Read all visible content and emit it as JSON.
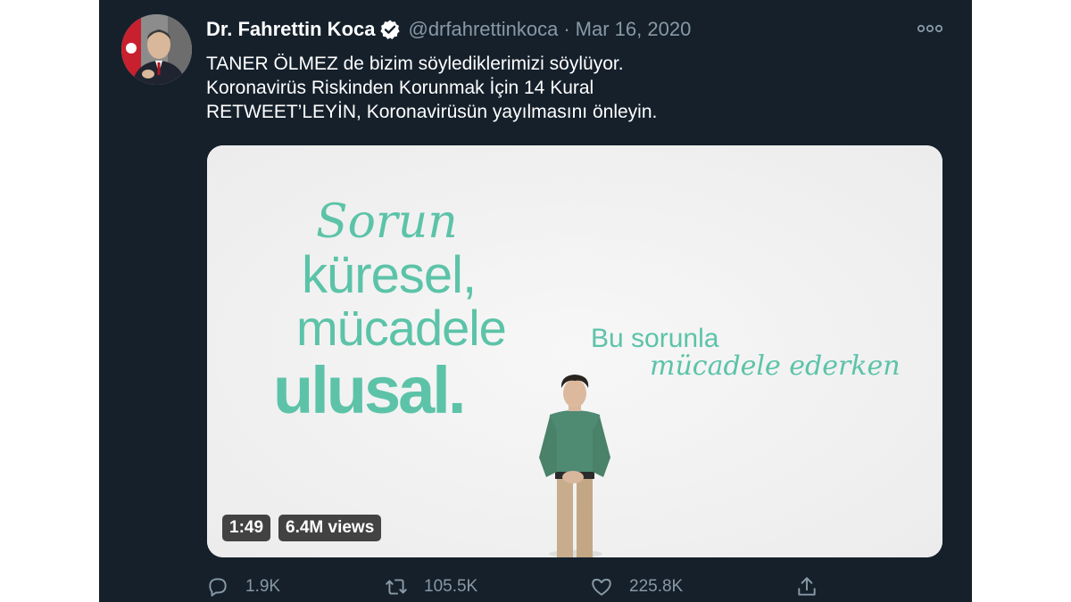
{
  "tweet": {
    "author": {
      "display_name": "Dr. Fahrettin Koca",
      "handle": "@drfahrettinkoca",
      "verified_icon": "verified-badge-icon"
    },
    "separator": "·",
    "date": "Mar 16, 2020",
    "more_icon": "more-horizontal-icon",
    "text_lines": [
      "TANER ÖLMEZ de bizim söylediklerimizi söylüyor.",
      "Koronavirüs Riskinden Korunmak İçin 14 Kural",
      "RETWEET’LEYİN, Koronavirüsün yayılmasını önleyin."
    ],
    "media": {
      "slogan_lines": [
        "Sorun",
        "küresel,",
        "mücadele",
        "ulusal.",
        "Bu sorunla",
        "mücadele ederken"
      ],
      "accent_color": "#5cc3a8",
      "duration": "1:49",
      "views": "6.4M views"
    },
    "actions": {
      "reply": {
        "icon": "reply-icon",
        "count": "1.9K"
      },
      "retweet": {
        "icon": "retweet-icon",
        "count": "105.5K"
      },
      "like": {
        "icon": "heart-icon",
        "count": "225.8K"
      },
      "share": {
        "icon": "share-icon"
      }
    }
  },
  "colors": {
    "background": "#15202b",
    "text_primary": "#ffffff",
    "text_secondary": "#8899a6",
    "verified_blue": "#1da1f2"
  }
}
